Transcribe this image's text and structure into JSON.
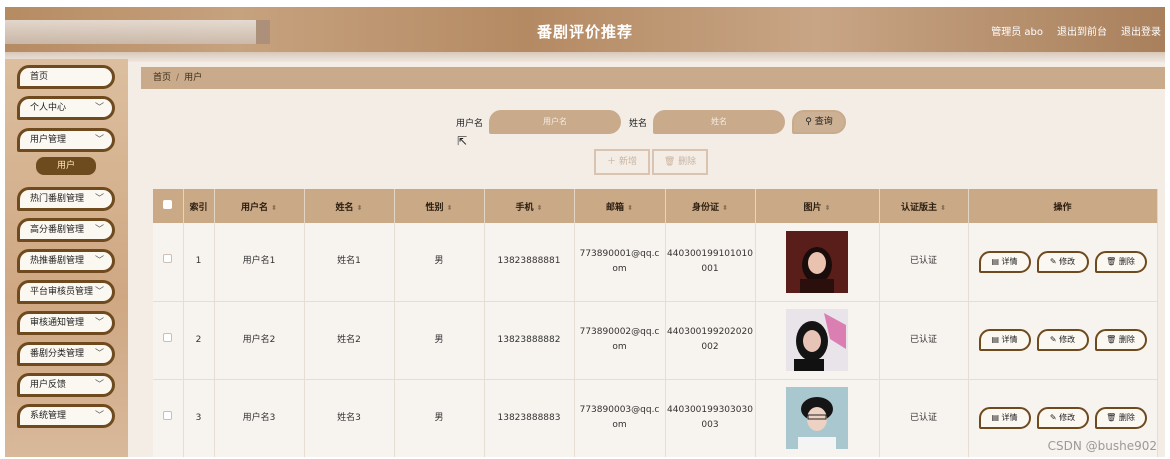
{
  "header": {
    "title": "番剧评价推荐",
    "admin_label": "管理员 abo",
    "front_link": "退出到前台",
    "logout_link": "退出登录"
  },
  "sidebar": {
    "items": [
      {
        "label": "首页",
        "has_chevron": false
      },
      {
        "label": "个人中心",
        "has_chevron": true
      },
      {
        "label": "用户管理",
        "has_chevron": true
      },
      {
        "label": "热门番剧管理",
        "has_chevron": true
      },
      {
        "label": "高分番剧管理",
        "has_chevron": true
      },
      {
        "label": "热推番剧管理",
        "has_chevron": true
      },
      {
        "label": "平台审核员管理",
        "has_chevron": true
      },
      {
        "label": "审核通知管理",
        "has_chevron": true
      },
      {
        "label": "番剧分类管理",
        "has_chevron": true
      },
      {
        "label": "用户反馈",
        "has_chevron": true
      },
      {
        "label": "系统管理",
        "has_chevron": true
      }
    ],
    "active_sub": "用户"
  },
  "breadcrumb": {
    "home": "首页",
    "current": "用户"
  },
  "search": {
    "username_label": "用户名",
    "username_placeholder": "用户名",
    "name_label": "姓名",
    "name_placeholder": "姓名",
    "query_button": "查询"
  },
  "actions": {
    "add": "新增",
    "delete": "删除"
  },
  "table": {
    "headers": [
      "索引",
      "用户名",
      "姓名",
      "性别",
      "手机",
      "邮箱",
      "身份证",
      "图片",
      "认证版主",
      "操作"
    ],
    "rows": [
      {
        "index": "1",
        "username": "用户名1",
        "name": "姓名1",
        "gender": "男",
        "phone": "13823888881",
        "email_l1": "773890001@qq.c",
        "email_l2": "om",
        "id_l1": "440300199101010",
        "id_l2": "001",
        "verified": "已认证"
      },
      {
        "index": "2",
        "username": "用户名2",
        "name": "姓名2",
        "gender": "男",
        "phone": "13823888882",
        "email_l1": "773890002@qq.c",
        "email_l2": "om",
        "id_l1": "440300199202020",
        "id_l2": "002",
        "verified": "已认证"
      },
      {
        "index": "3",
        "username": "用户名3",
        "name": "姓名3",
        "gender": "男",
        "phone": "13823888883",
        "email_l1": "773890003@qq.c",
        "email_l2": "om",
        "id_l1": "440300199303030",
        "id_l2": "003",
        "verified": "已认证"
      }
    ],
    "row_actions": {
      "detail": "详情",
      "edit": "修改",
      "delete": "删除"
    }
  },
  "watermark": "CSDN @bushe902",
  "colors": {
    "accent": "#6e4a1e",
    "tan": "#c9ab8b",
    "header_bg": "#b58b62"
  }
}
